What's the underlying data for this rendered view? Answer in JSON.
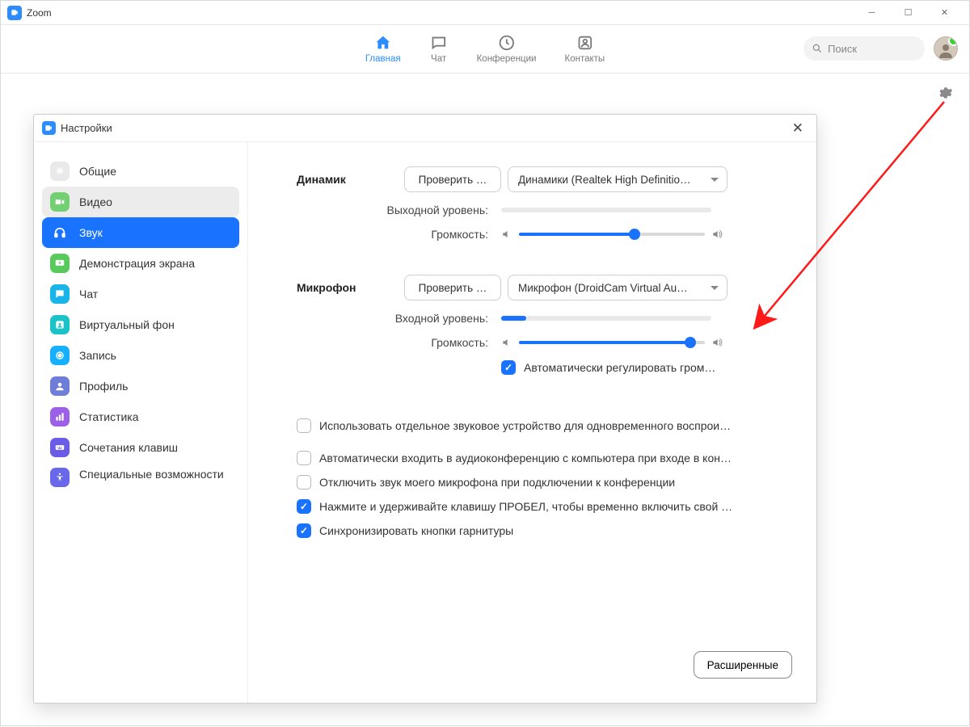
{
  "app": {
    "title": "Zoom"
  },
  "nav": {
    "home": "Главная",
    "chat": "Чат",
    "meetings": "Конференции",
    "contacts": "Контакты"
  },
  "search": {
    "placeholder": "Поиск"
  },
  "settings": {
    "title": "Настройки",
    "sidebar": [
      {
        "id": "general",
        "label": "Общие"
      },
      {
        "id": "video",
        "label": "Видео"
      },
      {
        "id": "audio",
        "label": "Звук"
      },
      {
        "id": "share",
        "label": "Демонстрация экрана"
      },
      {
        "id": "chat",
        "label": "Чат"
      },
      {
        "id": "vbg",
        "label": "Виртуальный фон"
      },
      {
        "id": "record",
        "label": "Запись"
      },
      {
        "id": "profile",
        "label": "Профиль"
      },
      {
        "id": "stats",
        "label": "Статистика"
      },
      {
        "id": "shortcuts",
        "label": "Сочетания клавиш"
      },
      {
        "id": "access",
        "label": "Специальные возможности"
      }
    ],
    "speaker": {
      "section": "Динамик",
      "test": "Проверить …",
      "device": "Динамики (Realtek High Definitio…",
      "output_label": "Выходной уровень:",
      "volume_label": "Громкость:",
      "output_level": 0,
      "volume": 62
    },
    "mic": {
      "section": "Микрофон",
      "test": "Проверить …",
      "device": "Микрофон (DroidCam Virtual Au…",
      "input_label": "Входной уровень:",
      "volume_label": "Громкость:",
      "input_level": 12,
      "volume": 92,
      "auto_adjust": {
        "checked": true,
        "label": "Автоматически регулировать гром…"
      }
    },
    "options": {
      "separate_device": {
        "checked": false,
        "label": "Использовать отдельное звуковое устройство для одновременного воспрои…"
      },
      "auto_join": {
        "checked": false,
        "label": "Автоматически входить в аудиоконференцию с компьютера при входе в кон…"
      },
      "mute_on_join": {
        "checked": false,
        "label": "Отключить звук моего микрофона при подключении к конференции"
      },
      "ptt": {
        "checked": true,
        "label": "Нажмите и удерживайте клавишу ПРОБЕЛ, чтобы временно включить свой …"
      },
      "sync_headset": {
        "checked": true,
        "label": "Синхронизировать кнопки гарнитуры"
      }
    },
    "advanced": "Расширенные"
  },
  "icons": {
    "general": {
      "bg": "#e9e9e9",
      "fg": "#fff"
    },
    "video": {
      "bg": "#72d072",
      "fg": "#fff"
    },
    "audio": {
      "bg": "#1a73ff",
      "fg": "#fff"
    },
    "share": {
      "bg": "#58c95b",
      "fg": "#fff"
    },
    "chat": {
      "bg": "#18b4ea",
      "fg": "#fff"
    },
    "vbg": {
      "bg": "#1bc3c9",
      "fg": "#fff"
    },
    "record": {
      "bg": "#16b0ff",
      "fg": "#fff"
    },
    "profile": {
      "bg": "#6d7dd8",
      "fg": "#fff"
    },
    "stats": {
      "bg": "#9c60e8",
      "fg": "#fff"
    },
    "shortcuts": {
      "bg": "#6a5ce6",
      "fg": "#fff"
    },
    "access": {
      "bg": "#6a68ea",
      "fg": "#fff"
    }
  }
}
